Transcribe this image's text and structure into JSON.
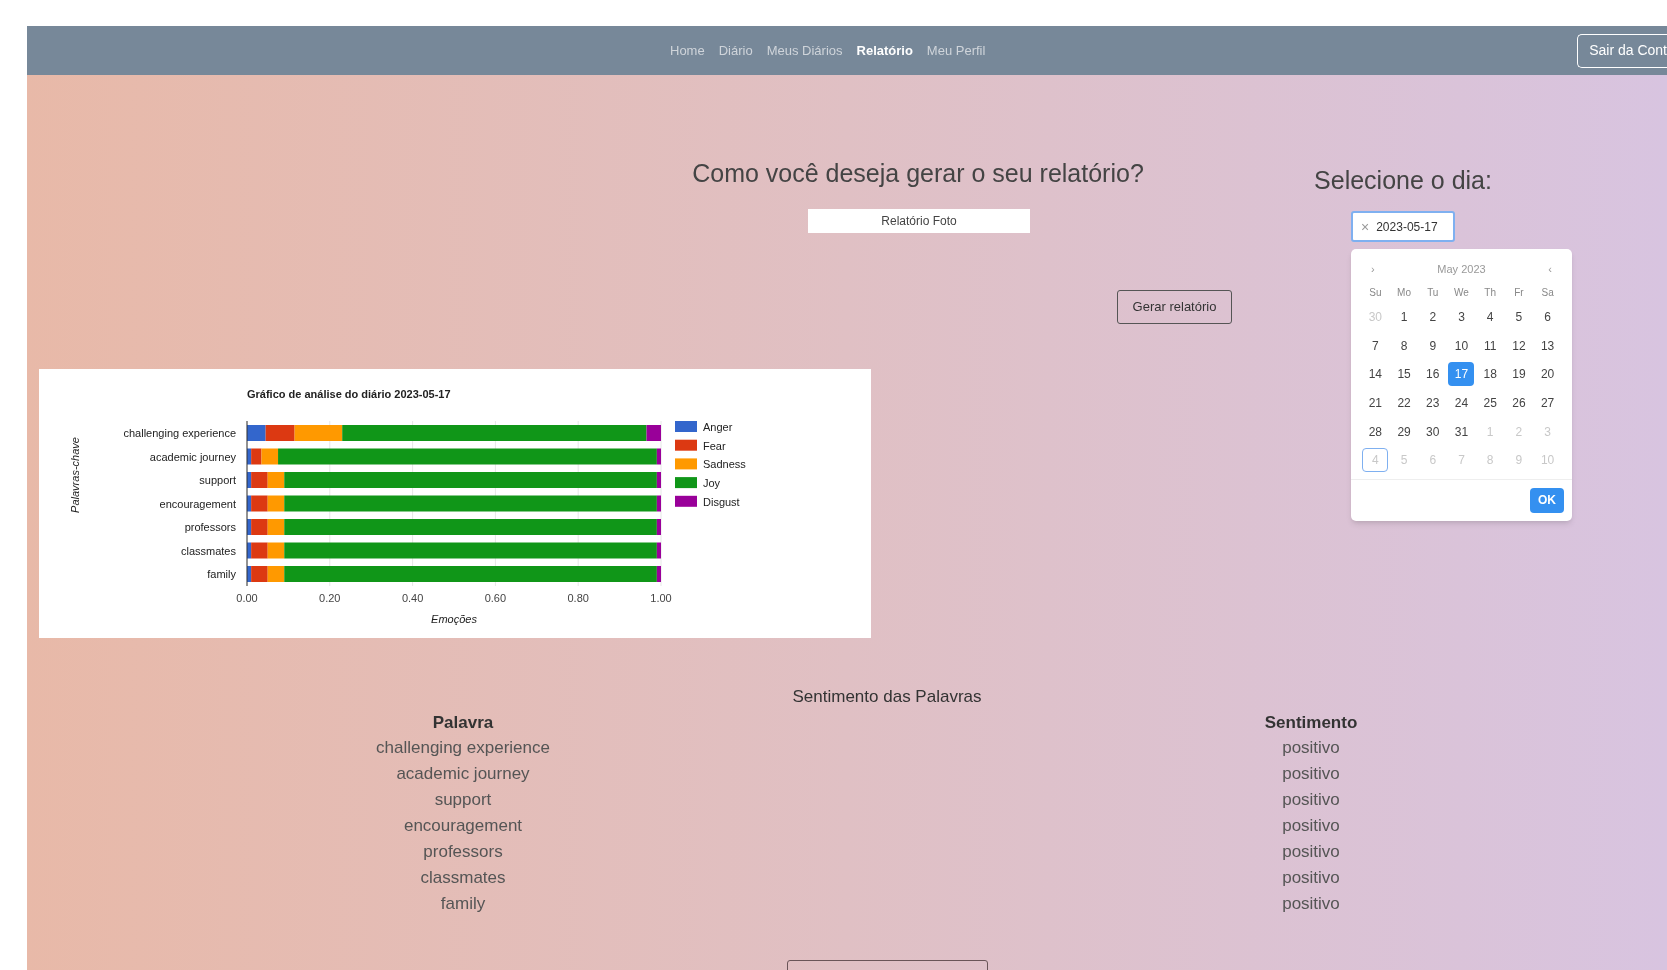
{
  "nav": {
    "links": [
      {
        "label": "Home",
        "selected": false
      },
      {
        "label": "Diário",
        "selected": false
      },
      {
        "label": "Meus Diários",
        "selected": false
      },
      {
        "label": "Relatório",
        "selected": true
      },
      {
        "label": "Meu Perfil",
        "selected": false
      }
    ],
    "logout_button": "Sair da Cont"
  },
  "report_type": {
    "heading": "Como você deseja gerar o seu relatório?",
    "select_value": "Relatório Foto",
    "generate_button": "Gerar relatório"
  },
  "date_picker": {
    "heading": "Selecione o dia:",
    "clear_icon": "×",
    "value": "2023-05-17",
    "calendar": {
      "nav_left": "›",
      "month_label": "May 2023",
      "nav_right": "‹",
      "weekdays": [
        "Su",
        "Mo",
        "Tu",
        "We",
        "Th",
        "Fr",
        "Sa"
      ],
      "days": [
        {
          "label": "30",
          "outside": true,
          "selected": false,
          "today": false
        },
        {
          "label": "1",
          "outside": false,
          "selected": false,
          "today": false
        },
        {
          "label": "2",
          "outside": false,
          "selected": false,
          "today": false
        },
        {
          "label": "3",
          "outside": false,
          "selected": false,
          "today": false
        },
        {
          "label": "4",
          "outside": false,
          "selected": false,
          "today": false
        },
        {
          "label": "5",
          "outside": false,
          "selected": false,
          "today": false
        },
        {
          "label": "6",
          "outside": false,
          "selected": false,
          "today": false
        },
        {
          "label": "7",
          "outside": false,
          "selected": false,
          "today": false
        },
        {
          "label": "8",
          "outside": false,
          "selected": false,
          "today": false
        },
        {
          "label": "9",
          "outside": false,
          "selected": false,
          "today": false
        },
        {
          "label": "10",
          "outside": false,
          "selected": false,
          "today": false
        },
        {
          "label": "11",
          "outside": false,
          "selected": false,
          "today": false
        },
        {
          "label": "12",
          "outside": false,
          "selected": false,
          "today": false
        },
        {
          "label": "13",
          "outside": false,
          "selected": false,
          "today": false
        },
        {
          "label": "14",
          "outside": false,
          "selected": false,
          "today": false
        },
        {
          "label": "15",
          "outside": false,
          "selected": false,
          "today": false
        },
        {
          "label": "16",
          "outside": false,
          "selected": false,
          "today": false
        },
        {
          "label": "17",
          "outside": false,
          "selected": true,
          "today": false
        },
        {
          "label": "18",
          "outside": false,
          "selected": false,
          "today": false
        },
        {
          "label": "19",
          "outside": false,
          "selected": false,
          "today": false
        },
        {
          "label": "20",
          "outside": false,
          "selected": false,
          "today": false
        },
        {
          "label": "21",
          "outside": false,
          "selected": false,
          "today": false
        },
        {
          "label": "22",
          "outside": false,
          "selected": false,
          "today": false
        },
        {
          "label": "23",
          "outside": false,
          "selected": false,
          "today": false
        },
        {
          "label": "24",
          "outside": false,
          "selected": false,
          "today": false
        },
        {
          "label": "25",
          "outside": false,
          "selected": false,
          "today": false
        },
        {
          "label": "26",
          "outside": false,
          "selected": false,
          "today": false
        },
        {
          "label": "27",
          "outside": false,
          "selected": false,
          "today": false
        },
        {
          "label": "28",
          "outside": false,
          "selected": false,
          "today": false
        },
        {
          "label": "29",
          "outside": false,
          "selected": false,
          "today": false
        },
        {
          "label": "30",
          "outside": false,
          "selected": false,
          "today": false
        },
        {
          "label": "31",
          "outside": false,
          "selected": false,
          "today": false
        },
        {
          "label": "1",
          "outside": true,
          "selected": false,
          "today": false
        },
        {
          "label": "2",
          "outside": true,
          "selected": false,
          "today": false
        },
        {
          "label": "3",
          "outside": true,
          "selected": false,
          "today": false
        },
        {
          "label": "4",
          "outside": true,
          "selected": false,
          "today": true
        },
        {
          "label": "5",
          "outside": true,
          "selected": false,
          "today": false
        },
        {
          "label": "6",
          "outside": true,
          "selected": false,
          "today": false
        },
        {
          "label": "7",
          "outside": true,
          "selected": false,
          "today": false
        },
        {
          "label": "8",
          "outside": true,
          "selected": false,
          "today": false
        },
        {
          "label": "9",
          "outside": true,
          "selected": false,
          "today": false
        },
        {
          "label": "10",
          "outside": true,
          "selected": false,
          "today": false
        }
      ],
      "ok_button": "OK"
    }
  },
  "chart": {
    "chart_data": {
      "type": "bar",
      "orientation": "horizontal",
      "stacked": true,
      "title": "Gráfico de análise do diário 2023-05-17",
      "xlabel": "Emoções",
      "ylabel": "Palavras-chave",
      "categories": [
        "challenging experience",
        "academic journey",
        "support",
        "encouragement",
        "professors",
        "classmates",
        "family"
      ],
      "series": [
        {
          "name": "Anger",
          "color": "#3366cc",
          "values": [
            0.045,
            0.01,
            0.01,
            0.01,
            0.01,
            0.01,
            0.01
          ]
        },
        {
          "name": "Fear",
          "color": "#dc3912",
          "values": [
            0.07,
            0.025,
            0.04,
            0.04,
            0.04,
            0.04,
            0.04
          ]
        },
        {
          "name": "Sadness",
          "color": "#ff9900",
          "values": [
            0.115,
            0.04,
            0.04,
            0.04,
            0.04,
            0.04,
            0.04
          ]
        },
        {
          "name": "Joy",
          "color": "#109618",
          "values": [
            0.735,
            0.915,
            0.9,
            0.9,
            0.9,
            0.9,
            0.9
          ]
        },
        {
          "name": "Disgust",
          "color": "#990099",
          "values": [
            0.035,
            0.01,
            0.01,
            0.01,
            0.01,
            0.01,
            0.01
          ]
        }
      ],
      "grid": true,
      "legend": true,
      "xlim": [
        0,
        1
      ],
      "xticks": [
        {
          "value": 0,
          "label": "0.00"
        },
        {
          "value": 0.2,
          "label": "0.20"
        },
        {
          "value": 0.4,
          "label": "0.40"
        },
        {
          "value": 0.6,
          "label": "0.60"
        },
        {
          "value": 0.8,
          "label": "0.80"
        },
        {
          "value": 1,
          "label": "1.00"
        }
      ]
    }
  },
  "sentiment_table": {
    "title": "Sentimento das Palavras",
    "columns": [
      "Palavra",
      "Sentimento"
    ],
    "rows": [
      [
        "challenging experience",
        "positivo"
      ],
      [
        "academic journey",
        "positivo"
      ],
      [
        "support",
        "positivo"
      ],
      [
        "encouragement",
        "positivo"
      ],
      [
        "professors",
        "positivo"
      ],
      [
        "classmates",
        "positivo"
      ],
      [
        "family",
        "positivo"
      ]
    ]
  }
}
